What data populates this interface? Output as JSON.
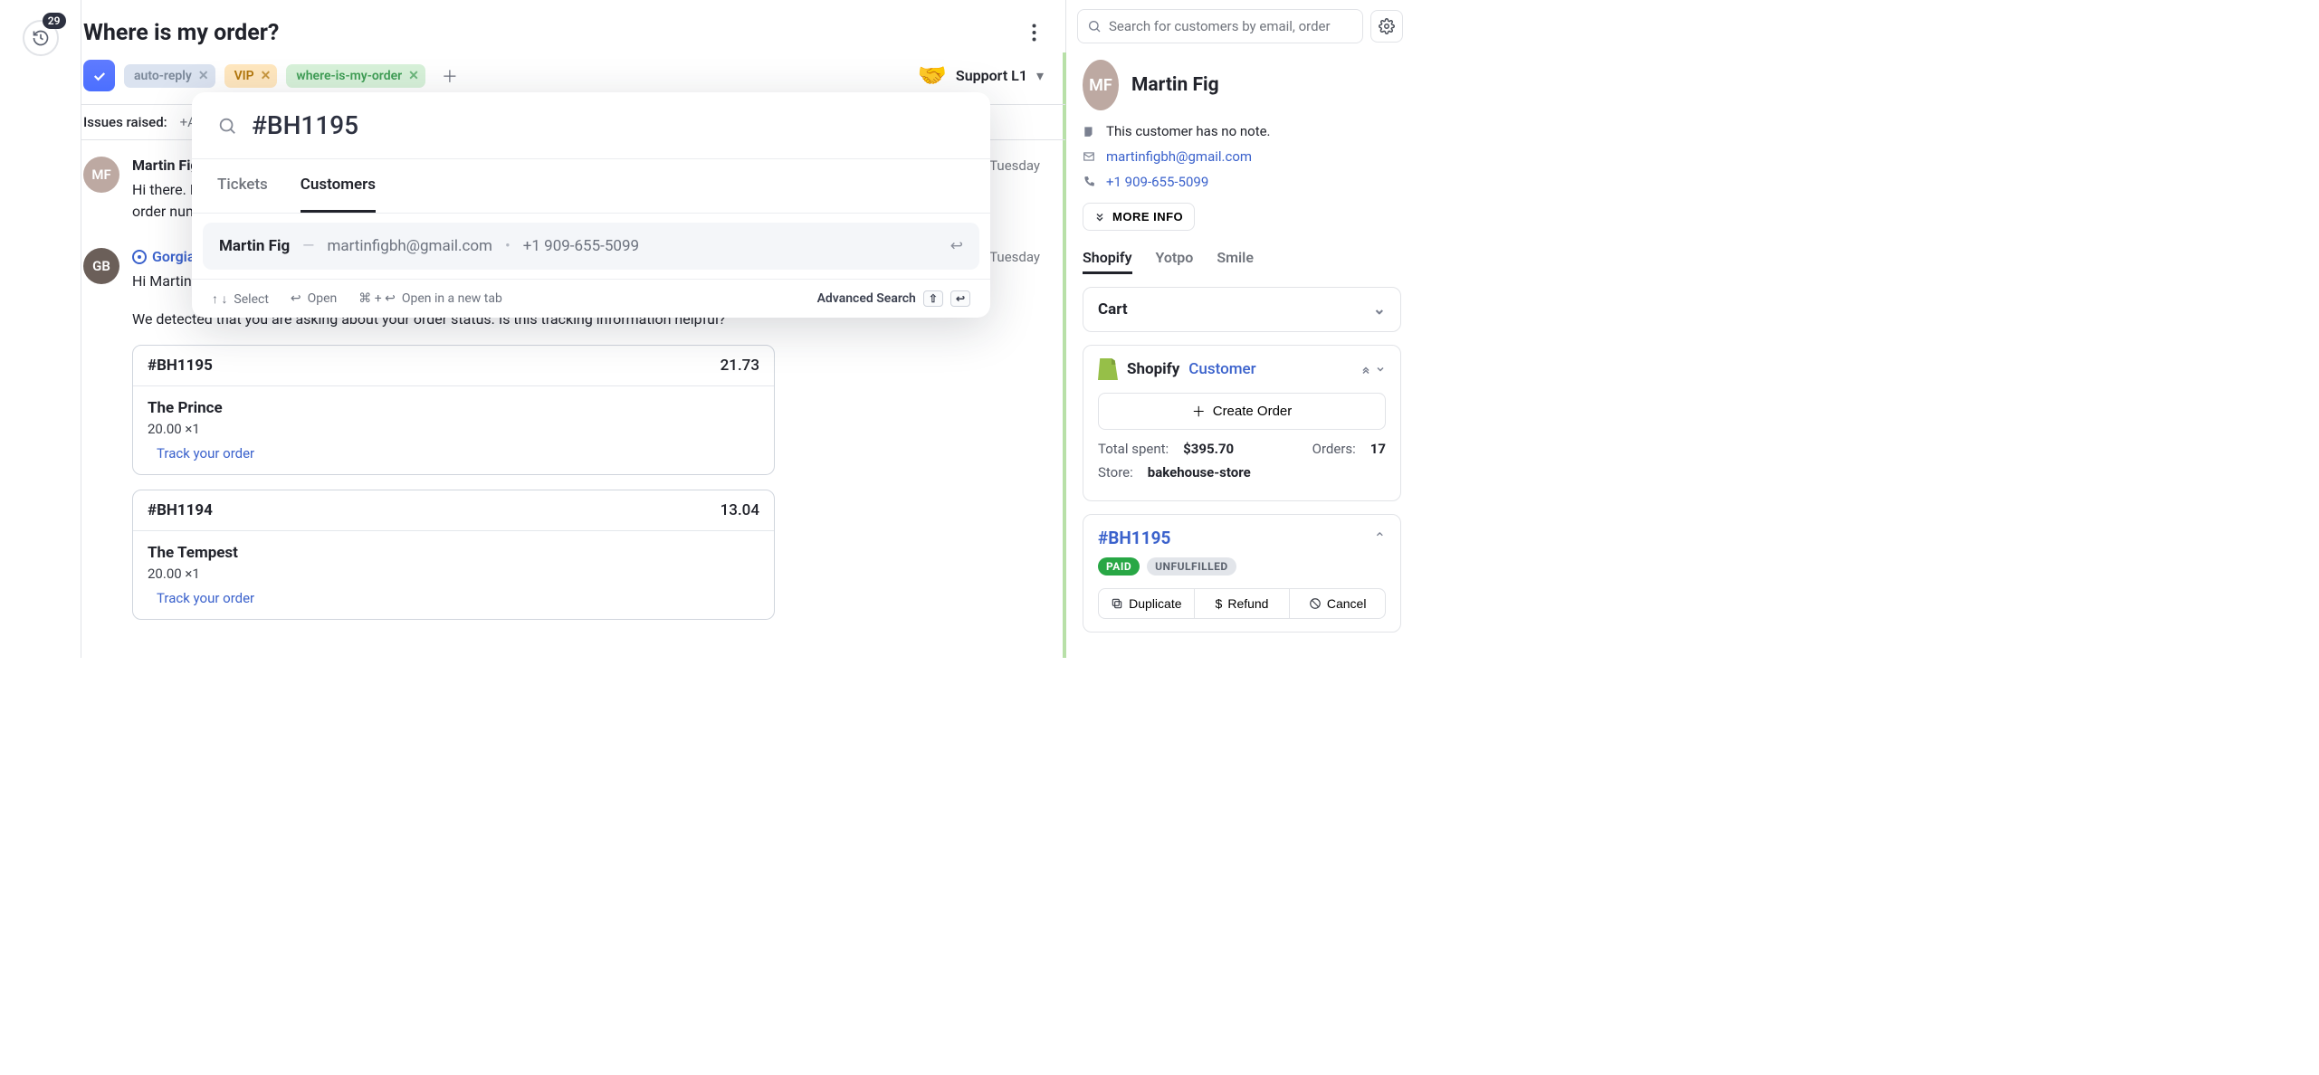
{
  "gutter": {
    "badge": "29"
  },
  "ticket": {
    "title": "Where is my order?",
    "tags": {
      "auto": "auto-reply",
      "vip": "VIP",
      "where": "where-is-my-order"
    },
    "assignee": {
      "team": "Support L1",
      "icon": "🤝"
    },
    "issues_label": "Issues raised:",
    "issues_add": "+Add"
  },
  "messages": {
    "m1": {
      "avatar": "MF",
      "sender": "Martin Fig",
      "time": "Tuesday",
      "text_start": "Hi there. I ordere",
      "text_end": "order number is"
    },
    "m2": {
      "avatar": "GB",
      "sender": "Gorgias Bot",
      "time": "Tuesday",
      "greeting": "Hi Martin,",
      "body": "We detected that you are asking about your order status. Is this tracking information helpful?"
    }
  },
  "orders": {
    "o1": {
      "num": "#BH1195",
      "amount": "21.73",
      "item": "The Prince",
      "line": "20.00 ×1",
      "track": "Track your order"
    },
    "o2": {
      "num": "#BH1194",
      "amount": "13.04",
      "item": "The Tempest",
      "line": "20.00 ×1",
      "track": "Track your order"
    }
  },
  "sidebar": {
    "search_placeholder": "Search for customers by email, order",
    "customer": {
      "initials": "MF",
      "name": "Martin Fig",
      "note": "This customer has no note.",
      "email": "martinfigbh@gmail.com",
      "phone": "+1 909-655-5099",
      "more": "MORE INFO"
    },
    "tabs": {
      "shopify": "Shopify",
      "yotpo": "Yotpo",
      "smile": "Smile"
    },
    "cart": {
      "title": "Cart"
    },
    "shopify": {
      "title": "Shopify",
      "customer_link": "Customer",
      "create": "Create Order",
      "total_k": "Total spent:",
      "total_v": "$395.70",
      "orders_k": "Orders:",
      "orders_v": "17",
      "store_k": "Store:",
      "store_v": "bakehouse-store"
    },
    "order": {
      "num": "#BH1195",
      "paid": "PAID",
      "unfulfilled": "UNFULFILLED",
      "actions": {
        "dup": "Duplicate",
        "refund": "Refund",
        "cancel": "Cancel"
      }
    }
  },
  "modal": {
    "query": "#BH1195",
    "tabs": {
      "tickets": "Tickets",
      "customers": "Customers"
    },
    "result": {
      "name": "Martin Fig",
      "dash": "—",
      "email": "martinfigbh@gmail.com",
      "dot": "•",
      "phone": "+1 909-655-5099"
    },
    "hints": {
      "select": "Select",
      "open": "Open",
      "cmd": "⌘ + ↩",
      "newtab": "Open in a new tab",
      "adv": "Advanced Search"
    }
  }
}
